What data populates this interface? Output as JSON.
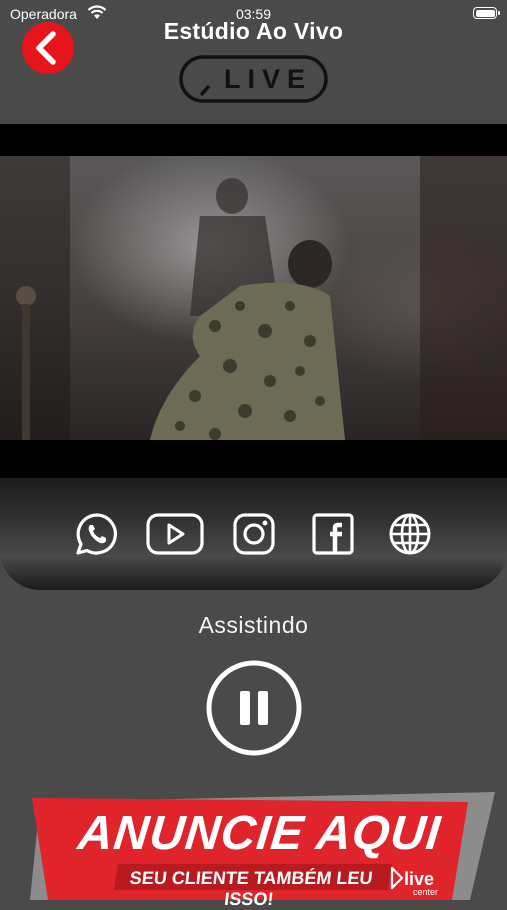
{
  "status": {
    "carrier": "Operadora",
    "time": "03:59"
  },
  "header": {
    "title": "Estúdio Ao Vivo",
    "logo_text": "LIVE"
  },
  "social": [
    "whatsapp-icon",
    "youtube-icon",
    "instagram-icon",
    "facebook-icon",
    "website-globe-icon"
  ],
  "player": {
    "status_label": "Assistindo"
  },
  "ad": {
    "title": "ANUNCIE AQUI",
    "subtitle": "SEU CLIENTE TAMBÉM LEU ISSO!",
    "brand": "live",
    "brand_sub": "center"
  },
  "colors": {
    "background": "#4a4a4a",
    "accent": "#e8141c",
    "ad_red": "#e0242b"
  }
}
